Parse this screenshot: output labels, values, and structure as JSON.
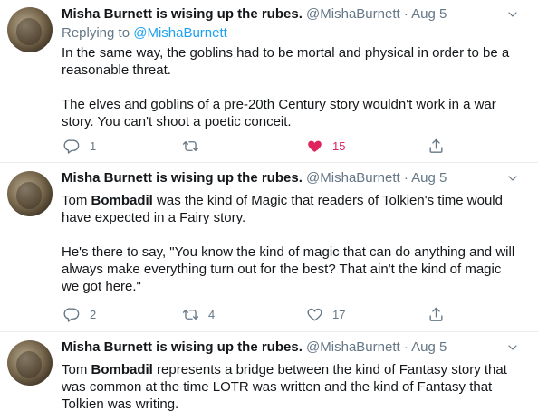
{
  "tweets": [
    {
      "name": "Misha Burnett is wising up the rubes.",
      "handle": "@MishaBurnett",
      "dot": "·",
      "date": "Aug 5",
      "replying_prefix": "Replying to",
      "replying_to": "@MishaBurnett",
      "paragraphs": [
        "In the same way, the goblins had to be mortal and physical in order to be a reasonable threat.",
        "The elves and goblins of a pre-20th Century story wouldn't work in a war story. You can't shoot a poetic conceit."
      ],
      "replies": "1",
      "retweets": "",
      "likes": "15",
      "liked": true
    },
    {
      "name": "Misha Burnett is wising up the rubes.",
      "handle": "@MishaBurnett",
      "dot": "·",
      "date": "Aug 5",
      "p1_before": "Tom ",
      "p1_bold": "Bombadil",
      "p1_after": " was the kind of Magic that readers of Tolkien's time would have expected in a Fairy story.",
      "p2": "He's there to say, \"You know the kind of magic that can do anything and will always make everything turn out for the best? That ain't the kind of magic we got here.\"",
      "replies": "2",
      "retweets": "4",
      "likes": "17",
      "liked": false
    },
    {
      "name": "Misha Burnett is wising up the rubes.",
      "handle": "@MishaBurnett",
      "dot": "·",
      "date": "Aug 5",
      "p1_before": "Tom ",
      "p1_bold": "Bombadil",
      "p1_after": " represents a bridge between the kind of Fantasy story that was common at the time LOTR was written and the kind of Fantasy that Tolkien was writing."
    }
  ],
  "icons": {
    "reply": "reply-icon",
    "retweet": "retweet-icon",
    "like": "heart-icon",
    "share": "share-icon",
    "caret": "chevron-down-icon"
  },
  "colors": {
    "text": "#14171a",
    "secondary": "#657786",
    "link": "#1da1f2",
    "like": "#e0245e",
    "border": "#e6ecf0"
  }
}
